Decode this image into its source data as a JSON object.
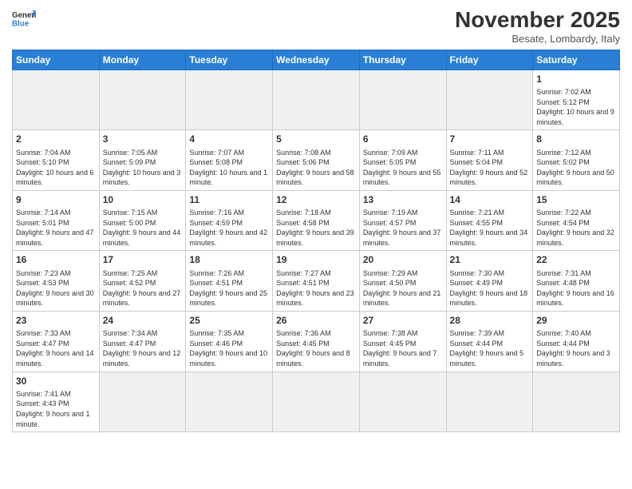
{
  "header": {
    "logo_general": "General",
    "logo_blue": "Blue",
    "month_title": "November 2025",
    "location": "Besate, Lombardy, Italy"
  },
  "weekdays": [
    "Sunday",
    "Monday",
    "Tuesday",
    "Wednesday",
    "Thursday",
    "Friday",
    "Saturday"
  ],
  "weeks": [
    [
      {
        "day": "",
        "info": ""
      },
      {
        "day": "",
        "info": ""
      },
      {
        "day": "",
        "info": ""
      },
      {
        "day": "",
        "info": ""
      },
      {
        "day": "",
        "info": ""
      },
      {
        "day": "",
        "info": ""
      },
      {
        "day": "1",
        "info": "Sunrise: 7:02 AM\nSunset: 5:12 PM\nDaylight: 10 hours and 9 minutes."
      }
    ],
    [
      {
        "day": "2",
        "info": "Sunrise: 7:04 AM\nSunset: 5:10 PM\nDaylight: 10 hours and 6 minutes."
      },
      {
        "day": "3",
        "info": "Sunrise: 7:05 AM\nSunset: 5:09 PM\nDaylight: 10 hours and 3 minutes."
      },
      {
        "day": "4",
        "info": "Sunrise: 7:07 AM\nSunset: 5:08 PM\nDaylight: 10 hours and 1 minute."
      },
      {
        "day": "5",
        "info": "Sunrise: 7:08 AM\nSunset: 5:06 PM\nDaylight: 9 hours and 58 minutes."
      },
      {
        "day": "6",
        "info": "Sunrise: 7:09 AM\nSunset: 5:05 PM\nDaylight: 9 hours and 55 minutes."
      },
      {
        "day": "7",
        "info": "Sunrise: 7:11 AM\nSunset: 5:04 PM\nDaylight: 9 hours and 52 minutes."
      },
      {
        "day": "8",
        "info": "Sunrise: 7:12 AM\nSunset: 5:02 PM\nDaylight: 9 hours and 50 minutes."
      }
    ],
    [
      {
        "day": "9",
        "info": "Sunrise: 7:14 AM\nSunset: 5:01 PM\nDaylight: 9 hours and 47 minutes."
      },
      {
        "day": "10",
        "info": "Sunrise: 7:15 AM\nSunset: 5:00 PM\nDaylight: 9 hours and 44 minutes."
      },
      {
        "day": "11",
        "info": "Sunrise: 7:16 AM\nSunset: 4:59 PM\nDaylight: 9 hours and 42 minutes."
      },
      {
        "day": "12",
        "info": "Sunrise: 7:18 AM\nSunset: 4:58 PM\nDaylight: 9 hours and 39 minutes."
      },
      {
        "day": "13",
        "info": "Sunrise: 7:19 AM\nSunset: 4:57 PM\nDaylight: 9 hours and 37 minutes."
      },
      {
        "day": "14",
        "info": "Sunrise: 7:21 AM\nSunset: 4:55 PM\nDaylight: 9 hours and 34 minutes."
      },
      {
        "day": "15",
        "info": "Sunrise: 7:22 AM\nSunset: 4:54 PM\nDaylight: 9 hours and 32 minutes."
      }
    ],
    [
      {
        "day": "16",
        "info": "Sunrise: 7:23 AM\nSunset: 4:53 PM\nDaylight: 9 hours and 30 minutes."
      },
      {
        "day": "17",
        "info": "Sunrise: 7:25 AM\nSunset: 4:52 PM\nDaylight: 9 hours and 27 minutes."
      },
      {
        "day": "18",
        "info": "Sunrise: 7:26 AM\nSunset: 4:51 PM\nDaylight: 9 hours and 25 minutes."
      },
      {
        "day": "19",
        "info": "Sunrise: 7:27 AM\nSunset: 4:51 PM\nDaylight: 9 hours and 23 minutes."
      },
      {
        "day": "20",
        "info": "Sunrise: 7:29 AM\nSunset: 4:50 PM\nDaylight: 9 hours and 21 minutes."
      },
      {
        "day": "21",
        "info": "Sunrise: 7:30 AM\nSunset: 4:49 PM\nDaylight: 9 hours and 18 minutes."
      },
      {
        "day": "22",
        "info": "Sunrise: 7:31 AM\nSunset: 4:48 PM\nDaylight: 9 hours and 16 minutes."
      }
    ],
    [
      {
        "day": "23",
        "info": "Sunrise: 7:33 AM\nSunset: 4:47 PM\nDaylight: 9 hours and 14 minutes."
      },
      {
        "day": "24",
        "info": "Sunrise: 7:34 AM\nSunset: 4:47 PM\nDaylight: 9 hours and 12 minutes."
      },
      {
        "day": "25",
        "info": "Sunrise: 7:35 AM\nSunset: 4:46 PM\nDaylight: 9 hours and 10 minutes."
      },
      {
        "day": "26",
        "info": "Sunrise: 7:36 AM\nSunset: 4:45 PM\nDaylight: 9 hours and 8 minutes."
      },
      {
        "day": "27",
        "info": "Sunrise: 7:38 AM\nSunset: 4:45 PM\nDaylight: 9 hours and 7 minutes."
      },
      {
        "day": "28",
        "info": "Sunrise: 7:39 AM\nSunset: 4:44 PM\nDaylight: 9 hours and 5 minutes."
      },
      {
        "day": "29",
        "info": "Sunrise: 7:40 AM\nSunset: 4:44 PM\nDaylight: 9 hours and 3 minutes."
      }
    ],
    [
      {
        "day": "30",
        "info": "Sunrise: 7:41 AM\nSunset: 4:43 PM\nDaylight: 9 hours and 1 minute."
      },
      {
        "day": "",
        "info": ""
      },
      {
        "day": "",
        "info": ""
      },
      {
        "day": "",
        "info": ""
      },
      {
        "day": "",
        "info": ""
      },
      {
        "day": "",
        "info": ""
      },
      {
        "day": "",
        "info": ""
      }
    ]
  ]
}
